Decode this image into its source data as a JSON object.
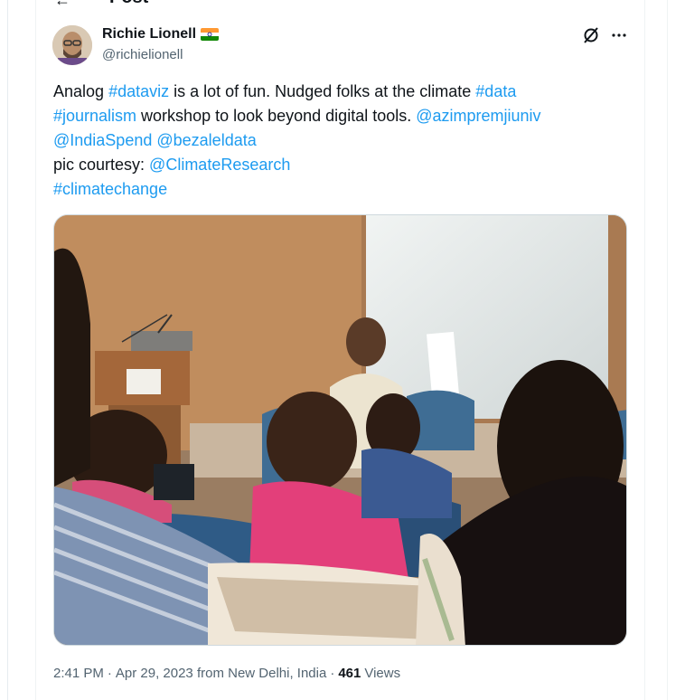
{
  "header": {
    "title": "Post"
  },
  "author": {
    "name": "Richie Lionell",
    "handle": "@richielionell",
    "flag_icon": "india-flag-icon"
  },
  "tweet": {
    "segments": [
      {
        "text": "Analog ",
        "link": false
      },
      {
        "text": "#dataviz",
        "link": true
      },
      {
        "text": " is a lot of fun. Nudged folks at the climate ",
        "link": false
      },
      {
        "text": "#data",
        "link": true
      },
      {
        "text": "\n",
        "link": false
      },
      {
        "text": "#journalism",
        "link": true
      },
      {
        "text": " workshop to look beyond digital tools. ",
        "link": false
      },
      {
        "text": "@azimpremjiuniv",
        "link": true
      },
      {
        "text": "\n",
        "link": false
      },
      {
        "text": "@IndiaSpend",
        "link": true
      },
      {
        "text": " ",
        "link": false
      },
      {
        "text": "@bezaleldata",
        "link": true
      },
      {
        "text": "\npic courtesy: ",
        "link": false
      },
      {
        "text": "@ClimateResearch",
        "link": true
      },
      {
        "text": "\n",
        "link": false
      },
      {
        "text": "#climatechange",
        "link": true
      }
    ]
  },
  "meta": {
    "time": "2:41 PM",
    "sep1": "·",
    "date": "Apr 29, 2023 from New Delhi, India",
    "sep2": "·",
    "views_count": "461",
    "views_label": "Views"
  },
  "colors": {
    "link": "#1d9bf0",
    "text": "#0f1419",
    "secondary": "#536471"
  },
  "icons": {
    "grok": "grok-icon",
    "more": "more-icon",
    "back": "back-arrow-icon"
  }
}
